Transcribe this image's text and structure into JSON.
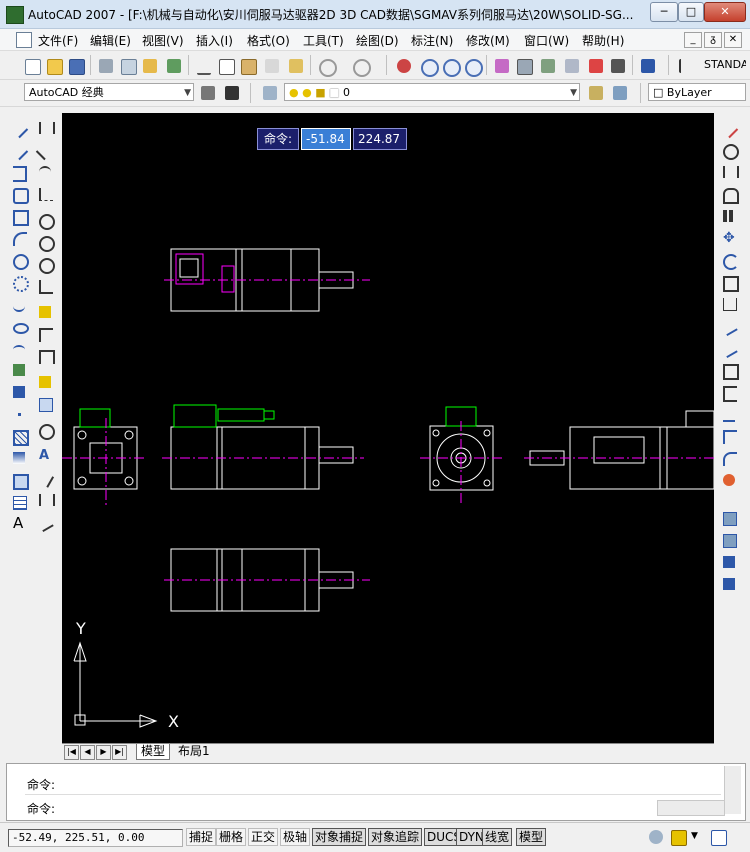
{
  "window": {
    "title": "AutoCAD 2007 - [F:\\机械与自动化\\安川伺服马达驱器2D 3D CAD数据\\SGMAV系列伺服马达\\20W\\SOLID-SG...",
    "min_label": "─",
    "max_label": "□",
    "close_label": "✕"
  },
  "menu": {
    "items": [
      "文件(F)",
      "编辑(E)",
      "视图(V)",
      "插入(I)",
      "格式(O)",
      "工具(T)",
      "绘图(D)",
      "标注(N)",
      "修改(M)",
      "窗口(W)",
      "帮助(H)"
    ],
    "mdi_min": "_",
    "mdi_restore": "ᵹ",
    "mdi_close": "✕"
  },
  "toolbar": {
    "text_style": "STANDAR",
    "workspace": "AutoCAD 经典",
    "layer": "0",
    "color": "ByLayer"
  },
  "canvas": {
    "command_prompt": "命令:",
    "input_x": "-51.84",
    "input_y": "224.87",
    "ucs_y": "Y",
    "ucs_x": "X"
  },
  "tabs": {
    "model": "模型",
    "layout1": "布局1"
  },
  "command": {
    "line1": "命令:",
    "line2": "命令:"
  },
  "status": {
    "coords": "-52.49, 225.51, 0.00",
    "buttons": [
      "捕捉",
      "栅格",
      "正交",
      "极轴",
      "对象捕捉",
      "对象追踪",
      "DUCS",
      "DYN",
      "线宽",
      "模型"
    ],
    "active": [
      "对象捕捉",
      "对象追踪",
      "DUCS",
      "DYN",
      "线宽",
      "模型"
    ]
  },
  "colors": {
    "canvas_bg": "#000000",
    "line_white": "#ffffff",
    "center_magenta": "#ff00ff",
    "connector_green": "#00ff00",
    "titlebar": "#d6e4f3"
  }
}
